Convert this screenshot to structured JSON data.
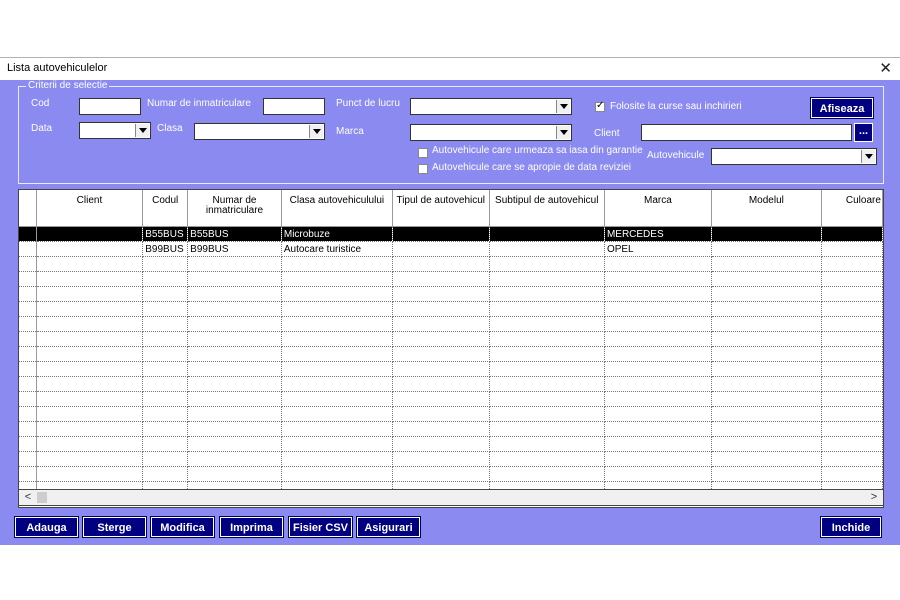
{
  "window": {
    "title": "Lista autovehiculelor"
  },
  "criteria": {
    "legend": "Criterii de selectie",
    "cod_label": "Cod",
    "nr_label": "Numar de inmatriculare",
    "punct_label": "Punct de lucru",
    "folosite_label": "Folosite la curse sau inchirieri",
    "folosite_checked": true,
    "data_label": "Data",
    "clasa_label": "Clasa",
    "marca_label": "Marca",
    "client_label": "Client",
    "garantie_label": "Autovehicule care urmeaza sa iasa din garantie",
    "revizie_label": "Autovehicule care se apropie de data reviziei",
    "autovehicule_label": "Autovehicule",
    "afiseaza": "Afiseaza",
    "dots": "..."
  },
  "table": {
    "columns": [
      "Client",
      "Codul",
      "Numar de\ninmatriculare",
      "Clasa autovehiculului",
      "Tipul de autovehicul",
      "Subtipul de autovehicul",
      "Marca",
      "Modelul",
      "Culoare"
    ],
    "rows": [
      [
        "",
        "B55BUS",
        "B55BUS",
        "Microbuze",
        "",
        "",
        "MERCEDES",
        "",
        ""
      ],
      [
        "",
        "B99BUS",
        "B99BUS",
        "Autocare turistice",
        "",
        "",
        "OPEL",
        "",
        ""
      ]
    ],
    "selected_row": 0,
    "empty_rows": 16
  },
  "buttons": {
    "adauga": "Adauga",
    "sterge": "Sterge",
    "modifica": "Modifica",
    "imprima": "Imprima",
    "csv": "Fisier CSV",
    "asigurari": "Asigurari",
    "inchide": "Inchide"
  }
}
